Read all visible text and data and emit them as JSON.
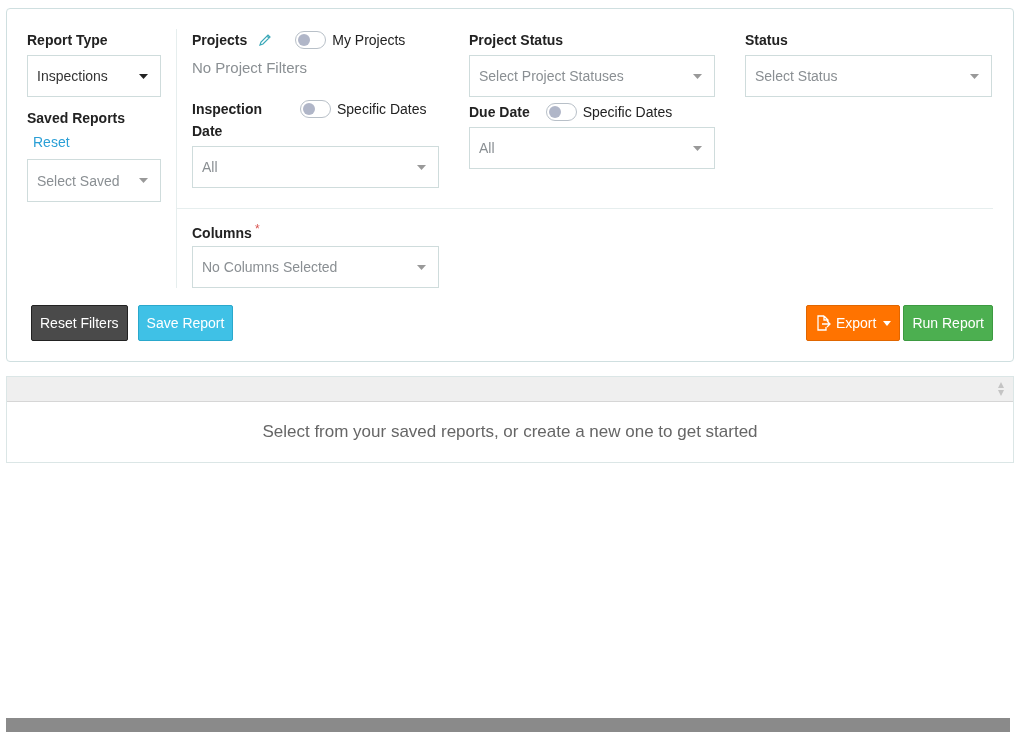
{
  "report_type": {
    "label": "Report Type",
    "value": "Inspections"
  },
  "saved_reports": {
    "label": "Saved Reports",
    "reset_link": "Reset",
    "placeholder": "Select Saved"
  },
  "projects": {
    "label": "Projects",
    "toggle": {
      "label": "My Projects",
      "on": false
    },
    "summary": "No Project Filters"
  },
  "project_status": {
    "label": "Project Status",
    "placeholder": "Select Project Statuses"
  },
  "status": {
    "label": "Status",
    "placeholder": "Select Status"
  },
  "inspection_date": {
    "label": "Inspection Date",
    "toggle": {
      "label": "Specific Dates",
      "on": false
    },
    "placeholder": "All"
  },
  "due_date": {
    "label": "Due Date",
    "toggle": {
      "label": "Specific Dates",
      "on": false
    },
    "placeholder": "All"
  },
  "columns": {
    "label": "Columns",
    "required_mark": "*",
    "placeholder": "No Columns Selected"
  },
  "left_buttons": [
    {
      "label": "Reset Filters",
      "kind": "dark"
    },
    {
      "label": "Save Report",
      "kind": "info"
    }
  ],
  "right_buttons": [
    {
      "label": "Export",
      "kind": "export"
    },
    {
      "label": "Run Report",
      "kind": "success"
    }
  ],
  "results": {
    "empty_message": "Select from your saved reports, or create a new one to get started"
  }
}
